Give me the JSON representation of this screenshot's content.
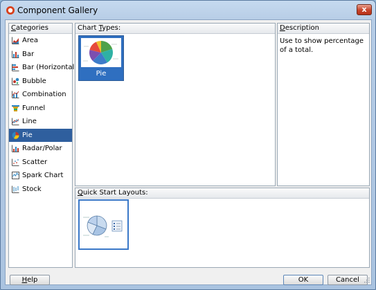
{
  "window": {
    "title": "Component Gallery",
    "close_label": "x"
  },
  "categories": {
    "header_prefix": "C",
    "header_rest": "ategories",
    "items": [
      {
        "label": "Area",
        "icon": "area-chart-icon"
      },
      {
        "label": "Bar",
        "icon": "bar-chart-icon"
      },
      {
        "label": "Bar (Horizontal)",
        "icon": "horizontal-bar-chart-icon"
      },
      {
        "label": "Bubble",
        "icon": "bubble-chart-icon"
      },
      {
        "label": "Combination",
        "icon": "combination-chart-icon"
      },
      {
        "label": "Funnel",
        "icon": "funnel-chart-icon"
      },
      {
        "label": "Line",
        "icon": "line-chart-icon"
      },
      {
        "label": "Pie",
        "icon": "pie-chart-icon"
      },
      {
        "label": "Radar/Polar",
        "icon": "radar-chart-icon"
      },
      {
        "label": "Scatter",
        "icon": "scatter-chart-icon"
      },
      {
        "label": "Spark Chart",
        "icon": "spark-chart-icon"
      },
      {
        "label": "Stock",
        "icon": "stock-chart-icon"
      }
    ],
    "selected": "Pie"
  },
  "chart_types": {
    "header_prefix": "Chart ",
    "header_u": "T",
    "header_rest": "ypes:",
    "items": [
      {
        "label": "Pie",
        "icon": "pie-chart-thumbnail"
      }
    ]
  },
  "description": {
    "header_prefix": "D",
    "header_rest": "escription",
    "text": "Use to show percentage of a total."
  },
  "quick_start": {
    "header_prefix": "Q",
    "header_rest": "uick Start Layouts:",
    "items": [
      {
        "icon": "pie-with-legend-layout-thumbnail"
      }
    ]
  },
  "buttons": {
    "help_u": "H",
    "help_rest": "elp",
    "ok": "OK",
    "cancel": "Cancel"
  },
  "colors": {
    "selection": "#2f5f9e",
    "accent": "#2f6fc0"
  }
}
